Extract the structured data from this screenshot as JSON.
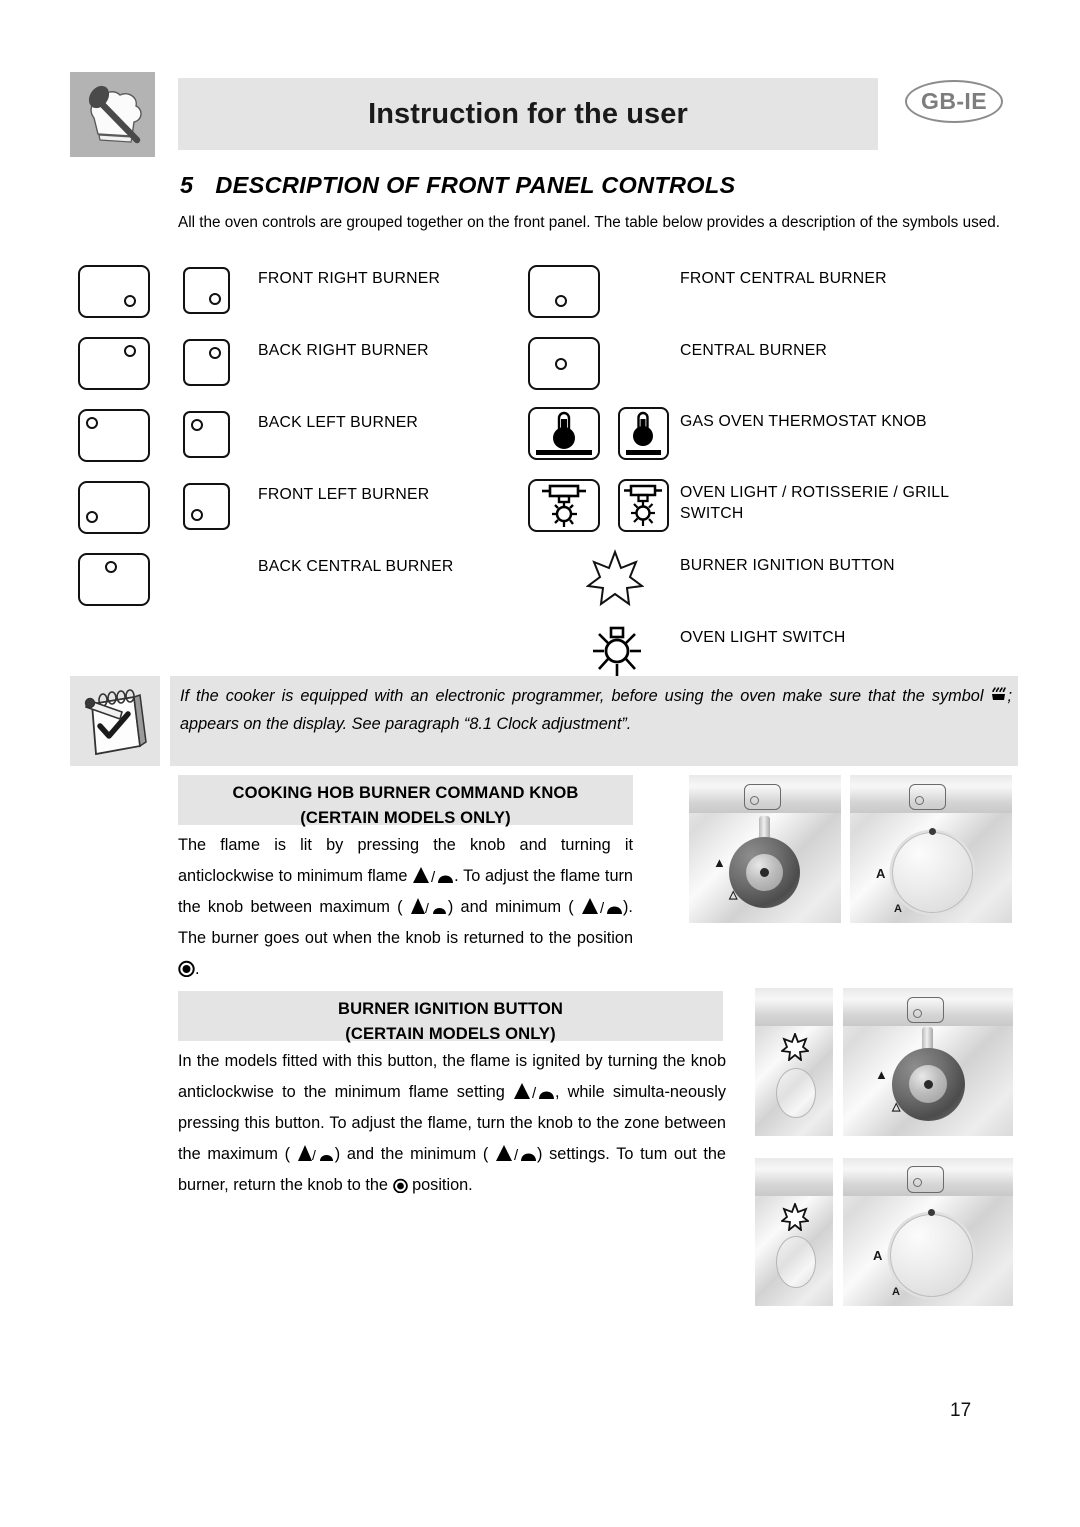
{
  "header": {
    "title": "Instruction for the user",
    "language_badge": "GB-IE",
    "chef_icon": "chef-hat-spoon-icon"
  },
  "section": {
    "number": "5",
    "heading": "DESCRIPTION OF FRONT PANEL CONTROLS",
    "intro": "All the oven controls are grouped together on the front panel. The table below provides a description of the symbols used."
  },
  "symbol_table": {
    "left_column": [
      {
        "label": "FRONT RIGHT BURNER",
        "icon": "knob-front-right-burner-icon"
      },
      {
        "label": "BACK RIGHT BURNER",
        "icon": "knob-back-right-burner-icon"
      },
      {
        "label": "BACK LEFT BURNER",
        "icon": "knob-back-left-burner-icon"
      },
      {
        "label": "FRONT LEFT BURNER",
        "icon": "knob-front-left-burner-icon"
      },
      {
        "label": "BACK CENTRAL BURNER",
        "icon": "knob-back-central-burner-icon"
      }
    ],
    "right_column": [
      {
        "label": "FRONT CENTRAL BURNER",
        "icon": "knob-front-central-burner-icon"
      },
      {
        "label": "CENTRAL BURNER",
        "icon": "knob-central-burner-icon"
      },
      {
        "label": "GAS OVEN THERMOSTAT KNOB",
        "icon": "thermostat-icon"
      },
      {
        "label": "OVEN LIGHT / ROTISSERIE / GRILL SWITCH",
        "icon": "oven-light-rotisserie-grill-icon"
      },
      {
        "label": "BURNER IGNITION BUTTON",
        "icon": "spark-star-icon"
      },
      {
        "label": "OVEN LIGHT SWITCH",
        "icon": "sun-lamp-icon"
      }
    ]
  },
  "note": {
    "icon": "notepad-pencil-check-icon",
    "text_before": "If the cooker is equipped with an electronic programmer, before using the oven make sure that the symbol",
    "symbol": "flame-display-icon",
    "text_after": "; appears on the display. See paragraph “8.1 Clock adjustment”."
  },
  "hob_knob_section": {
    "heading_line1": "COOKING HOB BURNER COMMAND KNOB",
    "heading_line2": "(CERTAIN MODELS ONLY)",
    "p1": "The flame is lit by pressing the knob and turning it anticlockwise to minimum flame",
    "p2": ". To adjust the flame turn the knob between maximum (",
    "p3": ") and minimum (",
    "p4": "). The burner goes out when the knob is returned to the position",
    "p5": "."
  },
  "ignition_section": {
    "heading_line1": "BURNER IGNITION BUTTON",
    "heading_line2": "(CERTAIN MODELS ONLY)",
    "p1": "In the models fitted with this button, the flame is ignited by turning the knob anticlockwise to the minimum flame setting",
    "p2": ", while simulta-neously pressing this button. To adjust the flame, turn the knob to the zone between the maximum (",
    "p3": ")  and the minimum (",
    "p4": ") settings.  To tum out the burner, return the knob to the",
    "p5": "position."
  },
  "photos": {
    "hob_knob_dark": {
      "name": "hob-knob-dark-photo",
      "mark_max": "▲",
      "mark_min": "△"
    },
    "hob_knob_light": {
      "name": "hob-knob-light-photo",
      "mark_max": "A",
      "mark_min": "A"
    },
    "ignition_button_1": {
      "name": "ignition-button-photo-dark"
    },
    "ignition_knob_dark": {
      "name": "ignition-knob-dark-photo"
    },
    "ignition_button_2": {
      "name": "ignition-button-photo-light"
    },
    "ignition_knob_light": {
      "name": "ignition-knob-light-photo"
    }
  },
  "footer": {
    "page_number": "17"
  },
  "colors": {
    "bar_gray": "#e4e4e4",
    "badge_gray": "#b3b3b3",
    "badge_text": "#7d7d7d",
    "ink": "#000000"
  }
}
